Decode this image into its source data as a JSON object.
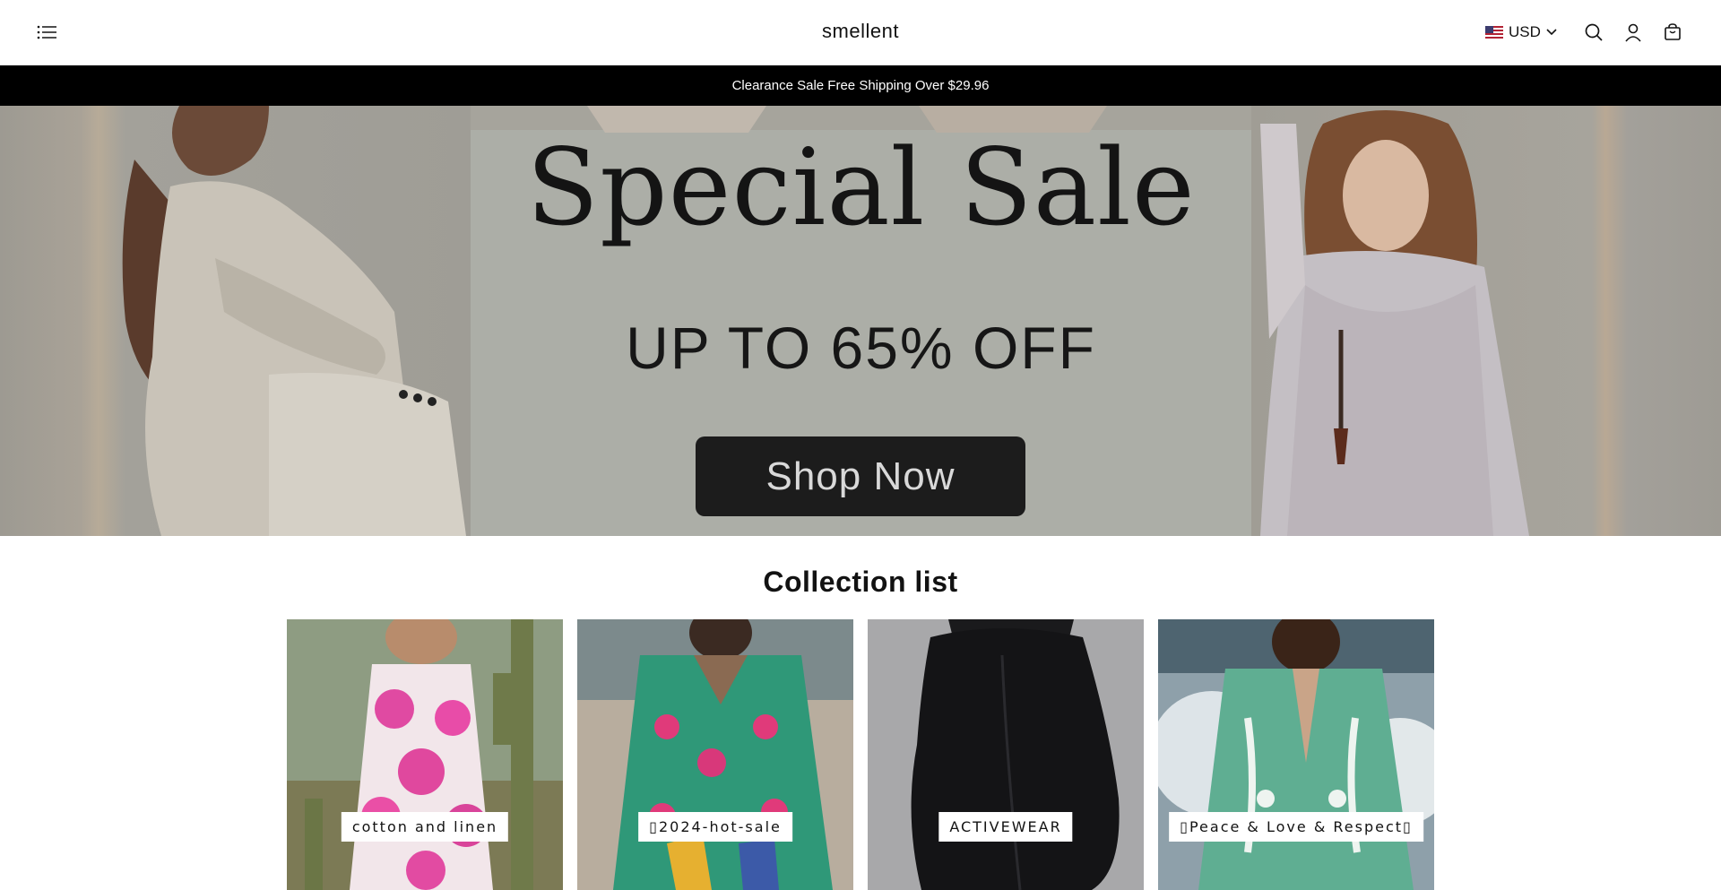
{
  "header": {
    "brand": "smellent",
    "currency": "USD",
    "menu_icon": "hamburger-icon",
    "currency_flag_icon": "us-flag-icon",
    "currency_chevron_icon": "chevron-down-icon",
    "search_icon": "search-icon",
    "account_icon": "account-icon",
    "cart_icon": "bag-icon"
  },
  "announcement": {
    "text": "Clearance Sale Free Shipping Over $29.96"
  },
  "hero": {
    "title": "Special Sale",
    "subtitle": "UP TO 65% OFF",
    "button": "Shop Now"
  },
  "collection": {
    "title": "Collection list",
    "items": [
      {
        "label": "cotton and linen"
      },
      {
        "label": "▯2024-hot-sale"
      },
      {
        "label": "ACTIVEWEAR"
      },
      {
        "label": "▯Peace & Love & Respect▯"
      }
    ]
  },
  "colors": {
    "announcement_bg": "#000000",
    "hero_button_bg": "#1c1c1c",
    "text": "#121212"
  }
}
